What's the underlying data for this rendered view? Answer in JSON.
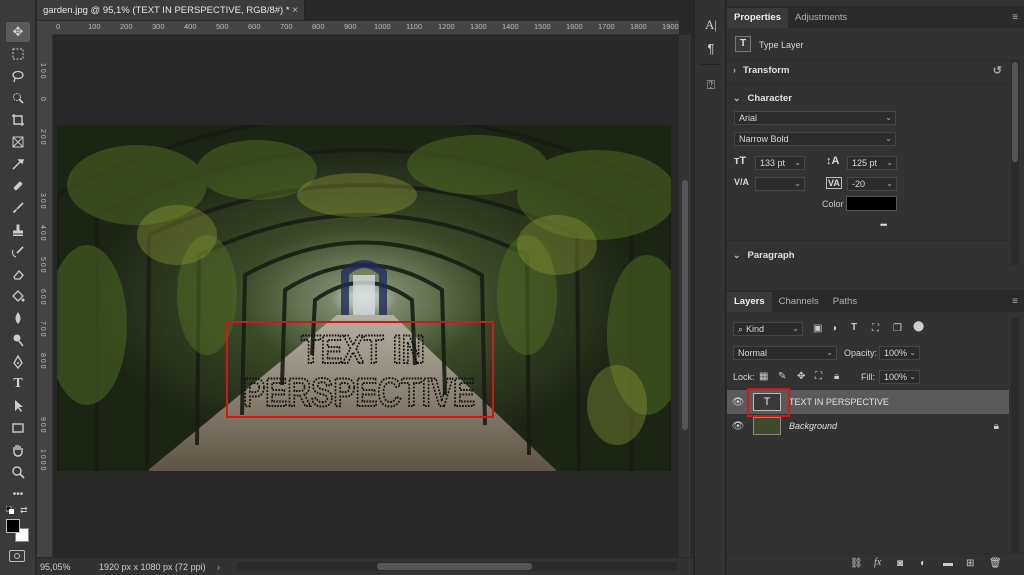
{
  "document": {
    "tab_title": "garden.jpg @ 95,1% (TEXT IN PERSPECTIVE, RGB/8#) *",
    "close_glyph": "×",
    "ruler_h": [
      "0",
      "100",
      "200",
      "300",
      "400",
      "500",
      "600",
      "700",
      "800",
      "900",
      "1000",
      "1100",
      "1200",
      "1300",
      "1400",
      "1500",
      "1600",
      "1700",
      "1800",
      "1900"
    ],
    "ruler_v": [
      "0",
      "1 0 0",
      "2 0 0",
      "3 0 0",
      "4 0 0",
      "5 0 0",
      "6 0 0",
      "7 0 0",
      "8 0 0",
      "9 0 0",
      "1 0 0 0"
    ],
    "canvas_text_line1": "TEXT IN",
    "canvas_text_line2": "PERSPECTIVE"
  },
  "status": {
    "zoom": "95,05%",
    "doc_size": "1920 px x 1080 px (72 ppi)",
    "arrow": "›"
  },
  "properties": {
    "tabs": [
      "Properties",
      "Adjustments"
    ],
    "layer_kind": "Type Layer",
    "transform_label": "Transform",
    "character_label": "Character",
    "font_family": "Arial",
    "font_style": "Narrow Bold",
    "font_size": "133 pt",
    "leading": "125 pt",
    "kerning": "",
    "tracking": "-20",
    "color_label": "Color",
    "text_color": "#000000",
    "more": "•••",
    "paragraph_label": "Paragraph"
  },
  "layers": {
    "tabs": [
      "Layers",
      "Channels",
      "Paths"
    ],
    "filter_kind": "Kind",
    "blend_mode": "Normal",
    "opacity_label": "Opacity:",
    "opacity_value": "100%",
    "lock_label": "Lock:",
    "fill_label": "Fill:",
    "fill_value": "100%",
    "items": [
      {
        "name": "TEXT IN PERSPECTIVE",
        "type_glyph": "T"
      },
      {
        "name": "Background"
      }
    ]
  },
  "colors": {
    "highlight": "#d01818",
    "selected_row": "#5a5a5a"
  }
}
